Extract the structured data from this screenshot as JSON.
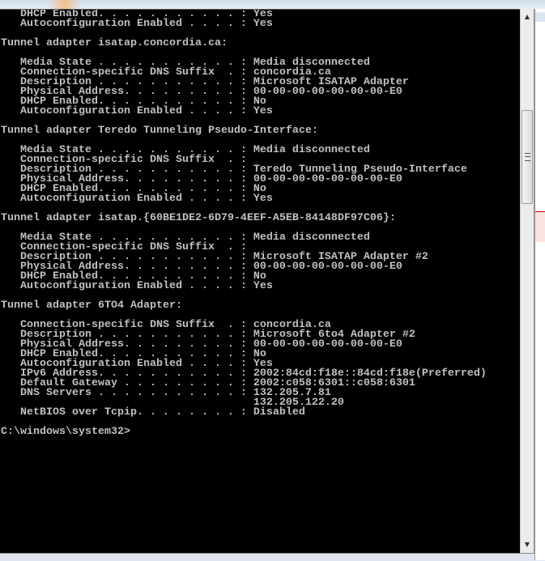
{
  "console": {
    "lines": [
      "   DHCP Enabled. . . . . . . . . . . : Yes",
      "   Autoconfiguration Enabled . . . . : Yes",
      "",
      "Tunnel adapter isatap.concordia.ca:",
      "",
      "   Media State . . . . . . . . . . . : Media disconnected",
      "   Connection-specific DNS Suffix  . : concordia.ca",
      "   Description . . . . . . . . . . . : Microsoft ISATAP Adapter",
      "   Physical Address. . . . . . . . . : 00-00-00-00-00-00-00-E0",
      "   DHCP Enabled. . . . . . . . . . . : No",
      "   Autoconfiguration Enabled . . . . : Yes",
      "",
      "Tunnel adapter Teredo Tunneling Pseudo-Interface:",
      "",
      "   Media State . . . . . . . . . . . : Media disconnected",
      "   Connection-specific DNS Suffix  . :",
      "   Description . . . . . . . . . . . : Teredo Tunneling Pseudo-Interface",
      "   Physical Address. . . . . . . . . : 00-00-00-00-00-00-00-E0",
      "   DHCP Enabled. . . . . . . . . . . : No",
      "   Autoconfiguration Enabled . . . . : Yes",
      "",
      "Tunnel adapter isatap.{60BE1DE2-6D79-4EEF-A5EB-84148DF97C06}:",
      "",
      "   Media State . . . . . . . . . . . : Media disconnected",
      "   Connection-specific DNS Suffix  . :",
      "   Description . . . . . . . . . . . : Microsoft ISATAP Adapter #2",
      "   Physical Address. . . . . . . . . : 00-00-00-00-00-00-00-E0",
      "   DHCP Enabled. . . . . . . . . . . : No",
      "   Autoconfiguration Enabled . . . . : Yes",
      "",
      "Tunnel adapter 6TO4 Adapter:",
      "",
      "   Connection-specific DNS Suffix  . : concordia.ca",
      "   Description . . . . . . . . . . . : Microsoft 6to4 Adapter #2",
      "   Physical Address. . . . . . . . . : 00-00-00-00-00-00-00-E0",
      "   DHCP Enabled. . . . . . . . . . . : No",
      "   Autoconfiguration Enabled . . . . : Yes",
      "   IPv6 Address. . . . . . . . . . . : 2002:84cd:f18e::84cd:f18e(Preferred)",
      "   Default Gateway . . . . . . . . . : 2002:c058:6301::c058:6301",
      "   DNS Servers . . . . . . . . . . . : 132.205.7.81",
      "                                       132.205.122.20",
      "   NetBIOS over Tcpip. . . . . . . . : Disabled",
      "",
      "C:\\windows\\system32>"
    ],
    "text_color": "#c0c0c0",
    "background": "#000000"
  },
  "scrollbar": {
    "up_icon": "scroll-up-arrow-icon",
    "down_icon": "scroll-down-arrow-icon",
    "thumb_glyph": "grip-icon"
  }
}
